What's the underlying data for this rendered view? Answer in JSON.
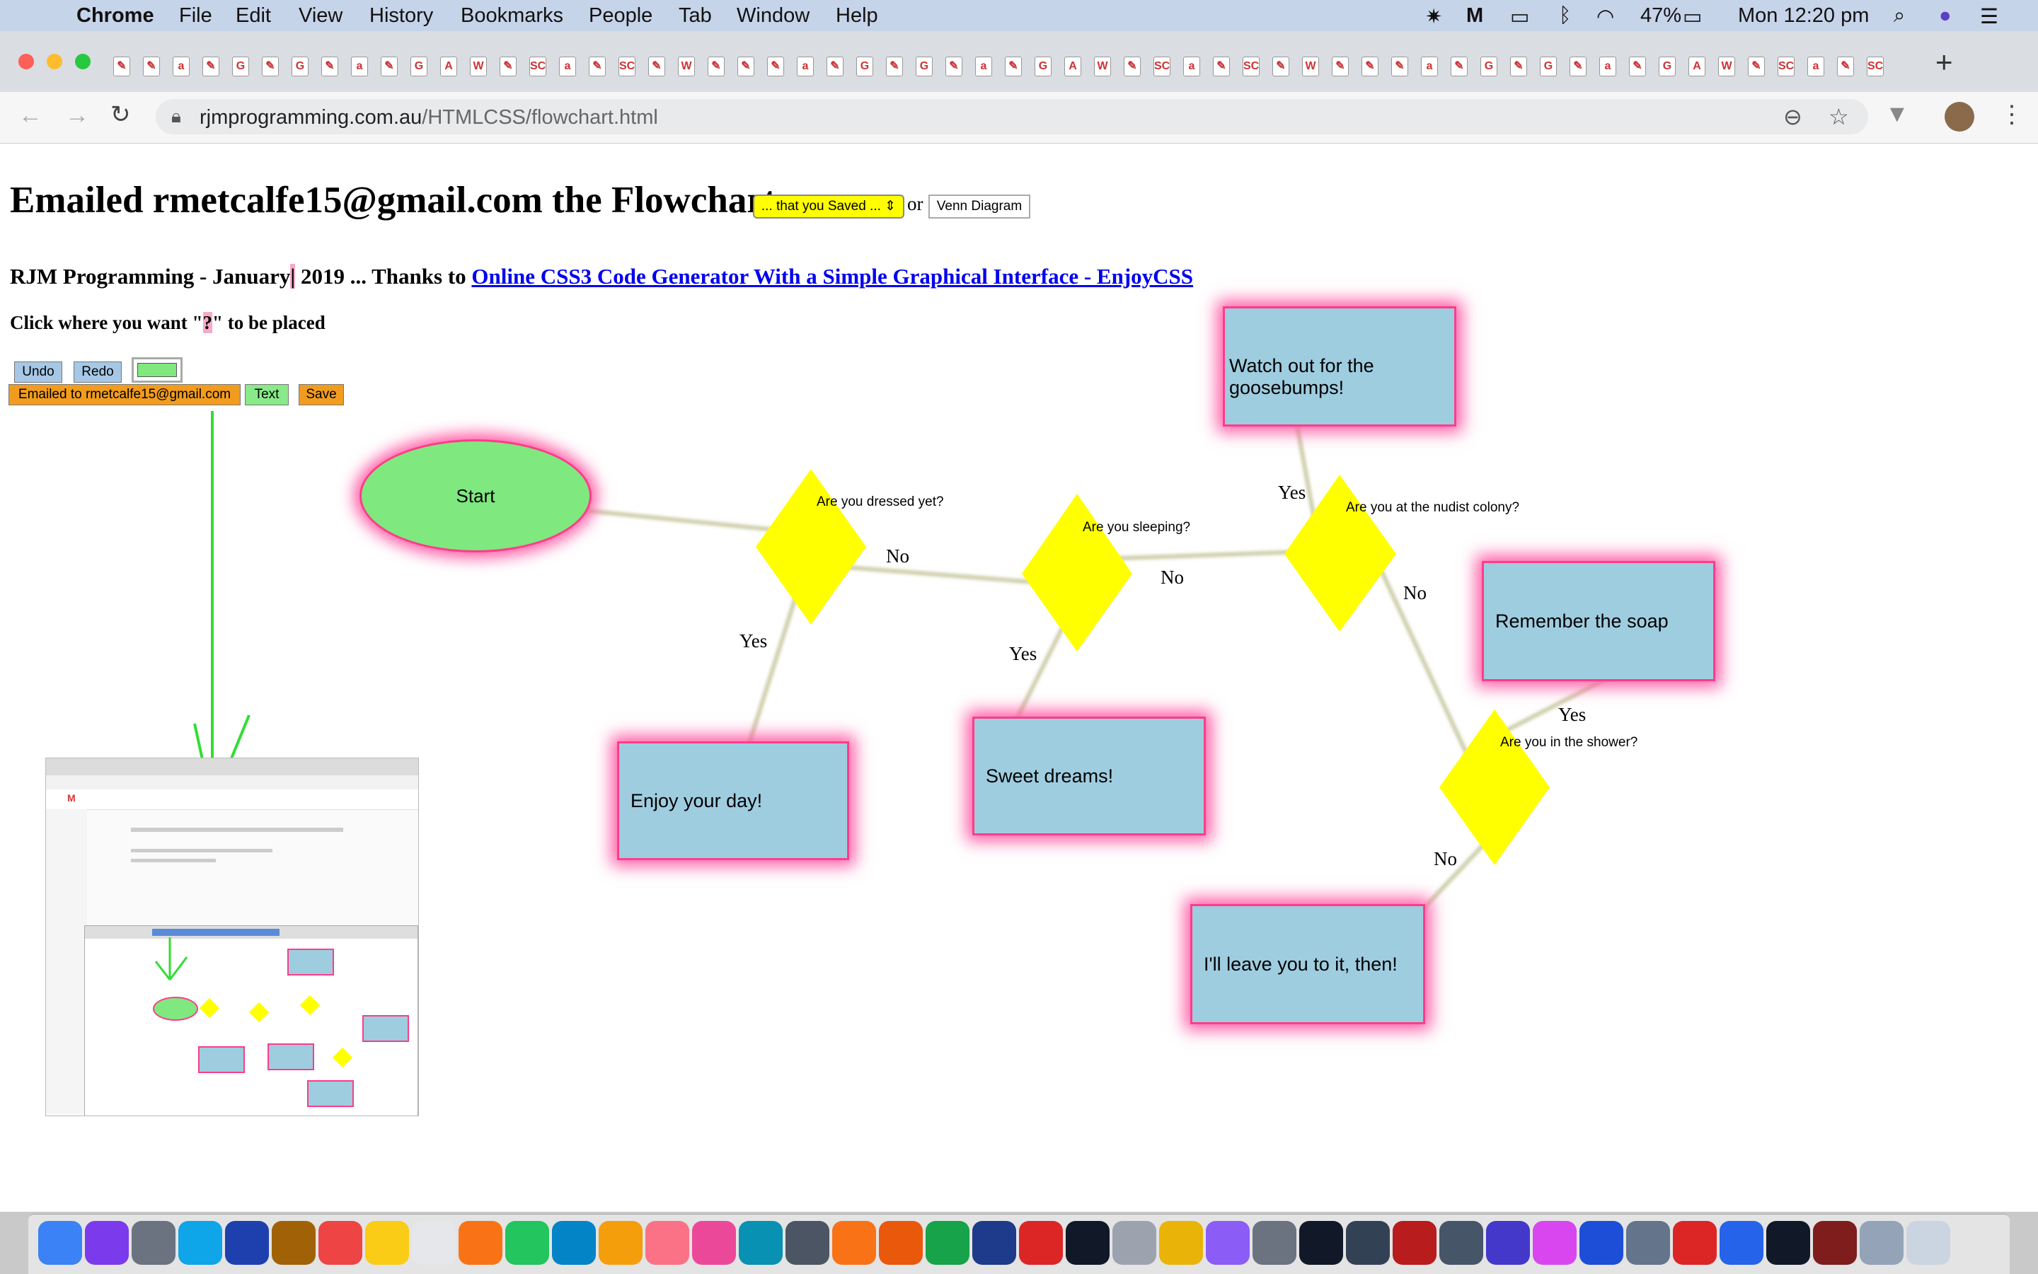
{
  "menubar": {
    "app": "Chrome",
    "items": [
      "File",
      "Edit",
      "View",
      "History",
      "Bookmarks",
      "People",
      "Tab",
      "Window",
      "Help"
    ],
    "battery": "47%",
    "clock": "Mon 12:20 pm"
  },
  "browser": {
    "url_host": "rjmprogramming.com.au",
    "url_path": "/HTMLCSS/flowchart.html",
    "new_tab": "+",
    "favicons": [
      "✎",
      "✎",
      "a",
      "✎",
      "G",
      "✎",
      "G",
      "✎",
      "a",
      "✎",
      "G",
      "A",
      "W",
      "✎",
      "SC",
      "a",
      "✎",
      "SC",
      "✎",
      "W",
      "✎"
    ]
  },
  "page": {
    "title": "Emailed rmetcalfe15@gmail.com the Flowchart",
    "saved_select": "... that you Saved ...",
    "or_text": "or",
    "venn_button": "Venn Diagram",
    "subtitle_pre": "RJM Programming - January",
    "subtitle_mark": "|",
    "subtitle_mid": " 2019 ... Thanks to ",
    "subtitle_link": "Online CSS3 Code Generator With a Simple Graphical Interface - EnjoyCSS",
    "instruction_pre": "Click where you want \"",
    "instruction_mark": "?",
    "instruction_post": "\" to be placed",
    "undo": "Undo",
    "redo": "Redo",
    "emailed_button": "Emailed to rmetcalfe15@gmail.com",
    "text_button": "Text",
    "save_button": "Save"
  },
  "flowchart": {
    "start": "Start",
    "q1": "Are you dressed yet?",
    "q2": "Are you sleeping?",
    "q3": "Are you at the nudist colony?",
    "q4": "Are you in the shower?",
    "b_enjoy": "Enjoy your day!",
    "b_sweet": "Sweet dreams!",
    "b_goose": "Watch out for the goosebumps!",
    "b_soap": "Remember the soap",
    "b_leave": "I'll leave you to it, then!",
    "yes": "Yes",
    "no": "No"
  },
  "colors": {
    "highlight": "#ff3c8a",
    "box_fill": "#9fcde0",
    "decision_fill": "#ffff00",
    "start_fill": "#7fe87f",
    "arrow": "#33dd33"
  }
}
